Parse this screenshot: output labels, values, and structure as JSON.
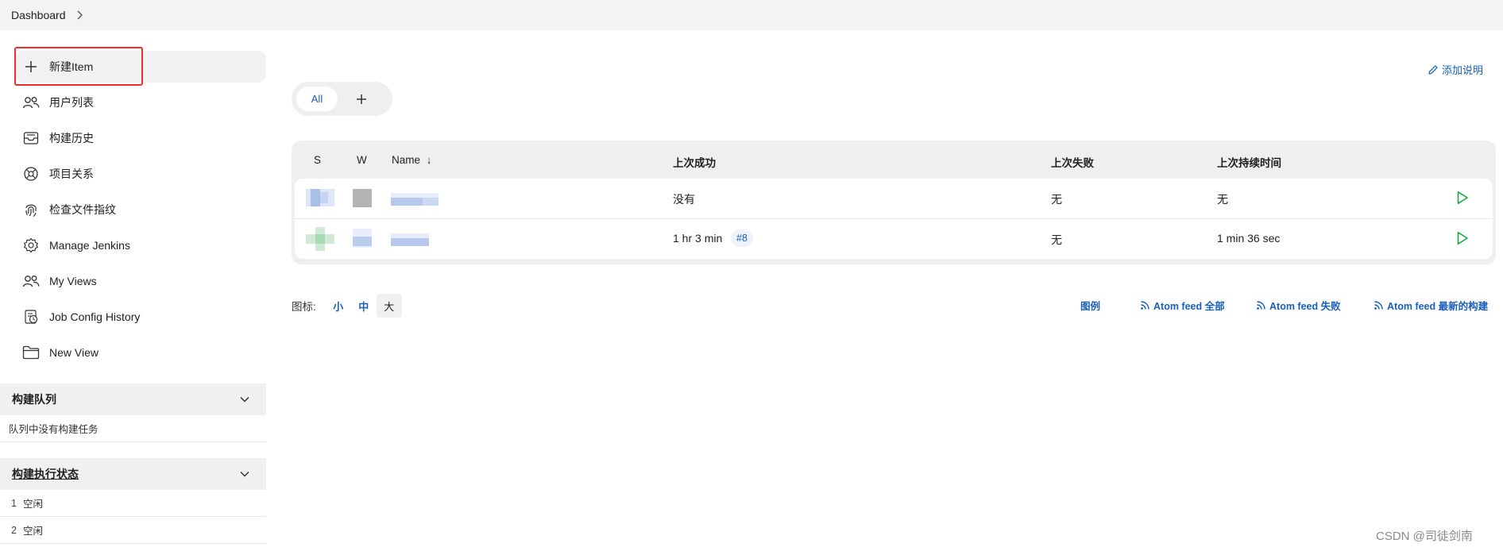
{
  "breadcrumb": {
    "root": "Dashboard"
  },
  "sidebar": {
    "items": [
      {
        "label": "新建Item",
        "icon": "plus-icon"
      },
      {
        "label": "用户列表",
        "icon": "users-icon"
      },
      {
        "label": "构建历史",
        "icon": "inbox-icon"
      },
      {
        "label": "项目关系",
        "icon": "relation-icon"
      },
      {
        "label": "检查文件指纹",
        "icon": "fingerprint-icon"
      },
      {
        "label": "Manage Jenkins",
        "icon": "gear-icon"
      },
      {
        "label": "My Views",
        "icon": "users-icon"
      },
      {
        "label": "Job Config History",
        "icon": "history-icon"
      },
      {
        "label": "New View",
        "icon": "folder-icon"
      }
    ],
    "build_queue": {
      "title": "构建队列",
      "empty_text": "队列中没有构建任务"
    },
    "executor_status": {
      "title": "构建执行状态",
      "executors": [
        {
          "num": "1",
          "status": "空闲"
        },
        {
          "num": "2",
          "status": "空闲"
        }
      ]
    }
  },
  "main": {
    "add_description": "添加说明",
    "tabs": {
      "all": "All"
    },
    "table": {
      "headers": {
        "s": "S",
        "w": "W",
        "name": "Name",
        "sort_arrow": "↓",
        "last_success": "上次成功",
        "last_failure": "上次失败",
        "last_duration": "上次持续时间"
      },
      "rows": [
        {
          "last_success": "没有",
          "build_badge": "",
          "last_failure": "无",
          "last_duration": "无"
        },
        {
          "last_success": "1 hr 3 min",
          "build_badge": "#8",
          "last_failure": "无",
          "last_duration": "1 min 36 sec"
        }
      ]
    },
    "icon_size": {
      "label": "图标:",
      "small": "小",
      "medium": "中",
      "large": "大"
    },
    "footer_links": {
      "legend": "图例",
      "atom_all": "Atom feed 全部",
      "atom_fail": "Atom feed 失败",
      "atom_latest": "Atom feed 最新的构建"
    }
  },
  "watermark": "CSDN @司徒剑南",
  "colors": {
    "accent": "#1b5fb8",
    "highlight": "#e8322b",
    "success": "#1ea446"
  }
}
